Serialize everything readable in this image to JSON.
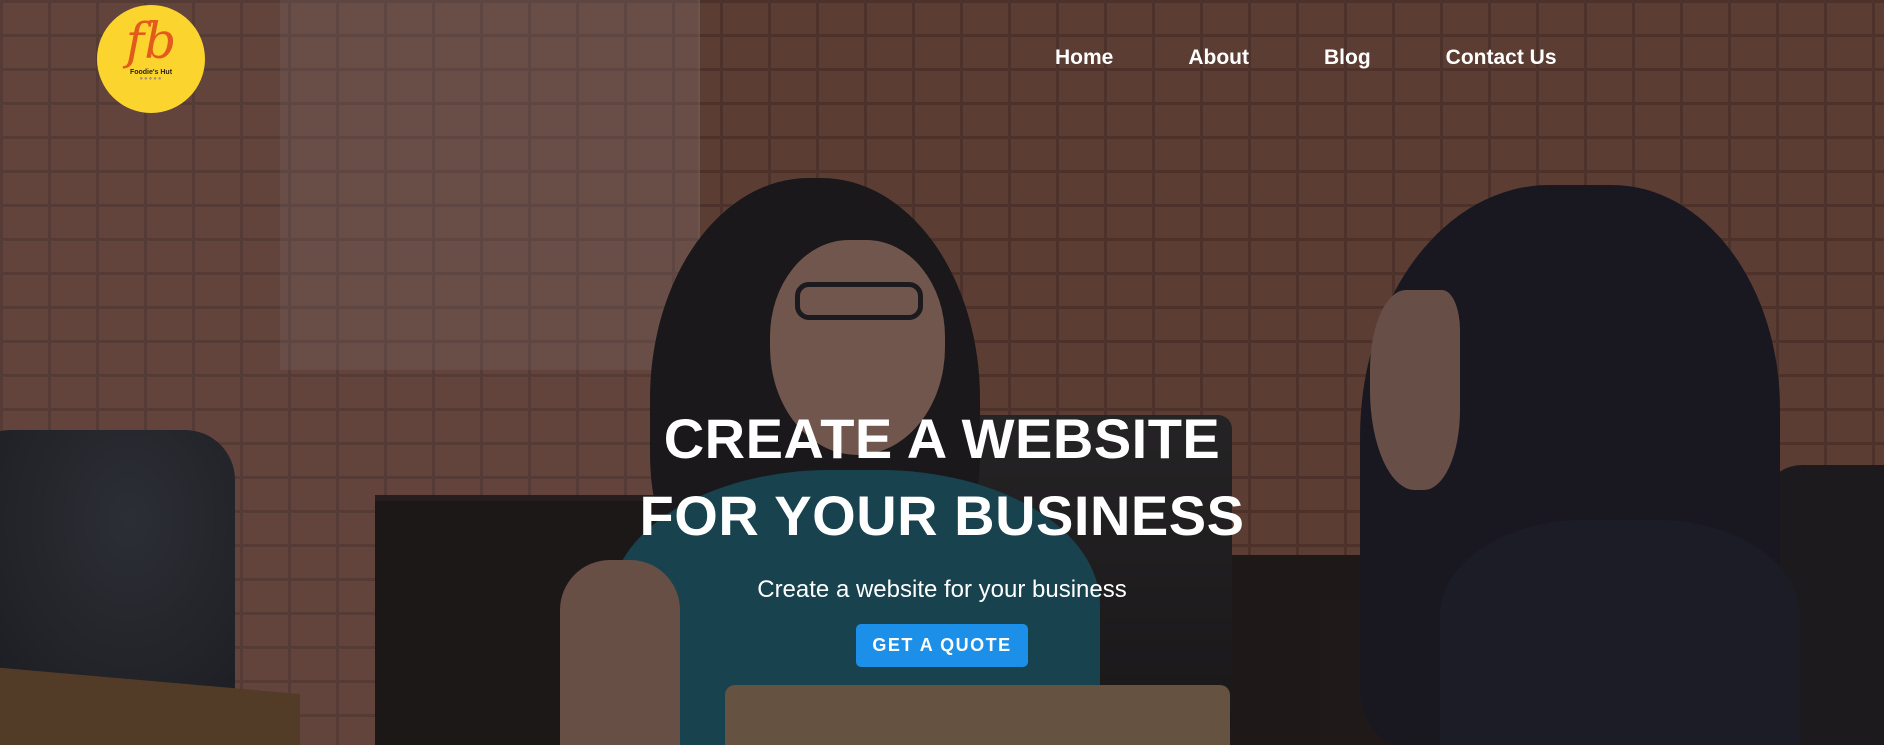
{
  "logo": {
    "mark": "fb",
    "text": "Foodie's Hut",
    "dots": "●●●●●"
  },
  "nav": {
    "items": [
      "Home",
      "About",
      "Blog",
      "Contact Us"
    ]
  },
  "hero": {
    "title_line1": "CREATE A WEBSITE",
    "title_line2": "FOR YOUR BUSINESS",
    "subtitle": "Create a website for your business",
    "cta_label": "GET A QUOTE"
  },
  "colors": {
    "cta": "#1c8fe8",
    "logo_bg": "#fbd42e",
    "logo_mark": "#e35b1c",
    "nav_text": "#ffffff"
  }
}
